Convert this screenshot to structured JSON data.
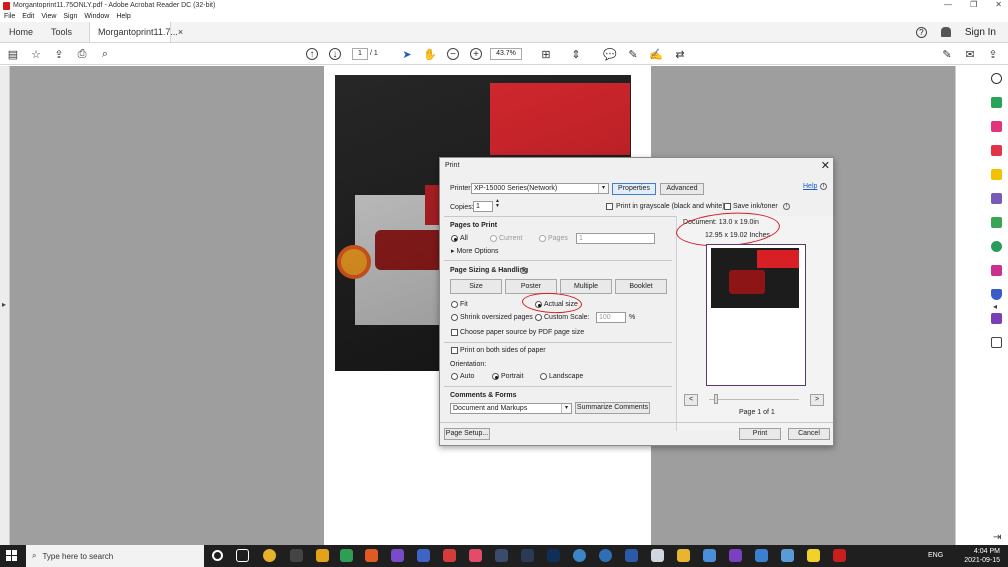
{
  "window": {
    "title": "Morgantoprint11.75ONLY.pdf - Adobe Acrobat Reader DC (32-bit)"
  },
  "menu": [
    "File",
    "Edit",
    "View",
    "Sign",
    "Window",
    "Help"
  ],
  "tabs": {
    "home": "Home",
    "tools": "Tools",
    "document": "Morgantoprint11.7...",
    "close": "×",
    "sign_in": "Sign In"
  },
  "toolbar": {
    "page_current": "1",
    "page_total": "/ 1",
    "zoom": "43.7%"
  },
  "print_dialog": {
    "title": "Print",
    "close": "✕",
    "help": "Help",
    "printer_label": "Printer:",
    "printer_value": "XP-15000 Series(Network)",
    "properties": "Properties",
    "advanced": "Advanced",
    "copies_label": "Copies:",
    "copies_value": "1",
    "grayscale": "Print in grayscale (black and white)",
    "save_ink": "Save ink/toner",
    "pages_to_print": "Pages to Print",
    "all": "All",
    "current": "Current",
    "pages": "Pages",
    "pages_value": "1",
    "more_options": "More Options",
    "page_sizing": "Page Sizing & Handling",
    "size": "Size",
    "poster": "Poster",
    "multiple": "Multiple",
    "booklet": "Booklet",
    "fit": "Fit",
    "actual_size": "Actual size",
    "shrink": "Shrink oversized pages",
    "custom_scale": "Custom Scale:",
    "custom_scale_value": "100",
    "percent": "%",
    "choose_paper": "Choose paper source by PDF page size",
    "both_sides": "Print on both sides of paper",
    "orientation": "Orientation:",
    "auto": "Auto",
    "portrait": "Portrait",
    "landscape": "Landscape",
    "comments_forms": "Comments & Forms",
    "comments_value": "Document and Markups",
    "summarize": "Summarize Comments",
    "document_size": "Document: 13.0 x 19.0in",
    "paper_size": "12.95 x 19.02 Inches",
    "prev": "<",
    "next": ">",
    "page_of": "Page 1 of 1",
    "page_setup": "Page Setup...",
    "print": "Print",
    "cancel": "Cancel"
  },
  "taskbar": {
    "search_placeholder": "Type here to search",
    "lang": "ENG",
    "time": "4:04 PM",
    "date": "2021-09-15"
  },
  "colors": {
    "accent_blue": "#3c7fd6",
    "annotation_red": "#d2202a",
    "acrobat_red": "#d7191c"
  }
}
